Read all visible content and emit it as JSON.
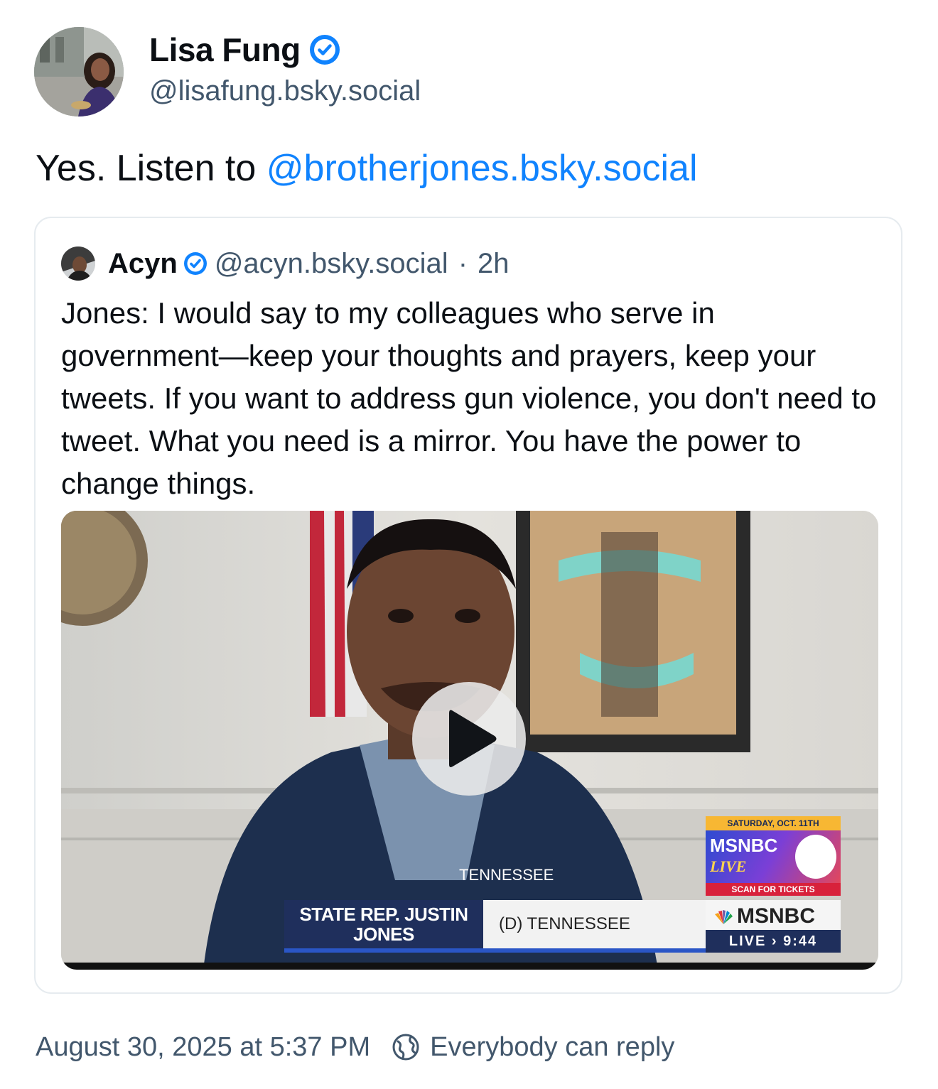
{
  "author": {
    "display_name": "Lisa Fung",
    "handle": "@lisafung.bsky.social",
    "verified": true
  },
  "post": {
    "text_prefix": "Yes. Listen to ",
    "mention": "@brotherjones.bsky.social"
  },
  "quoted_post": {
    "display_name": "Acyn",
    "handle": "@acyn.bsky.social",
    "separator": "·",
    "time_ago": "2h",
    "text": "Jones: I would say to my colleagues who serve in government—keep your thoughts and prayers, keep your tweets. If you want to address gun violence, you don't need to tweet. What you need is a mirror. You have the power to change things.",
    "video": {
      "chyron_name": "STATE REP. JUSTIN JONES",
      "chyron_party": "(D) TENNESSEE",
      "promo_date": "SATURDAY, OCT. 11TH",
      "promo_brand": "MSNBC",
      "promo_live": "LIVE",
      "promo_cta": "SCAN FOR TICKETS",
      "bug_brand": "MSNBC",
      "bug_live": "LIVE › 9:44",
      "jacket_text": "TENNESSEE"
    }
  },
  "footer": {
    "timestamp": "August 30, 2025 at 5:37 PM",
    "reply_setting": "Everybody can reply"
  },
  "colors": {
    "link": "#1083fe",
    "muted": "#42576c",
    "verified": "#1083fe",
    "border": "#e6ebef"
  }
}
